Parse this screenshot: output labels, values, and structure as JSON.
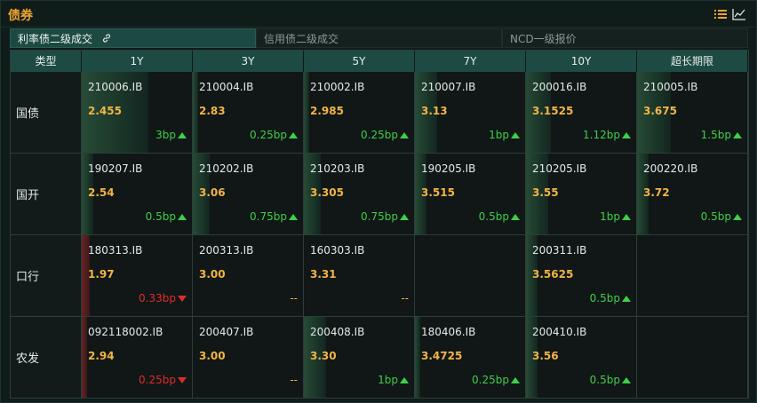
{
  "header": {
    "title": "债券",
    "list_icon": "list-icon",
    "chart_icon": "line-chart-icon",
    "accent": "#f0a531"
  },
  "tabs": [
    {
      "label": "利率债二级成交",
      "active": true,
      "icon": "link-icon"
    },
    {
      "label": "信用债二级成交",
      "active": false
    },
    {
      "label": "NCD一级报价",
      "active": false
    }
  ],
  "table": {
    "corner": "类型",
    "columns": [
      "1Y",
      "3Y",
      "5Y",
      "7Y",
      "10Y",
      "超长期限"
    ],
    "rows": [
      {
        "label": "国债",
        "cells": [
          {
            "code": "210006.IB",
            "yield": "2.455",
            "change": "3bp",
            "dir": "up",
            "bar": 0.6
          },
          {
            "code": "210004.IB",
            "yield": "2.83",
            "change": "0.25bp",
            "dir": "up",
            "bar": 0.05
          },
          {
            "code": "210002.IB",
            "yield": "2.985",
            "change": "0.25bp",
            "dir": "up",
            "bar": 0.05
          },
          {
            "code": "210007.IB",
            "yield": "3.13",
            "change": "1bp",
            "dir": "up",
            "bar": 0.2
          },
          {
            "code": "200016.IB",
            "yield": "3.1525",
            "change": "1.12bp",
            "dir": "up",
            "bar": 0.22
          },
          {
            "code": "210005.IB",
            "yield": "3.675",
            "change": "1.5bp",
            "dir": "up",
            "bar": 0.3
          }
        ]
      },
      {
        "label": "国开",
        "cells": [
          {
            "code": "190207.IB",
            "yield": "2.54",
            "change": "0.5bp",
            "dir": "up",
            "bar": 0.1
          },
          {
            "code": "210202.IB",
            "yield": "3.06",
            "change": "0.75bp",
            "dir": "up",
            "bar": 0.15
          },
          {
            "code": "210203.IB",
            "yield": "3.305",
            "change": "0.75bp",
            "dir": "up",
            "bar": 0.15
          },
          {
            "code": "190205.IB",
            "yield": "3.515",
            "change": "0.5bp",
            "dir": "up",
            "bar": 0.1
          },
          {
            "code": "210205.IB",
            "yield": "3.55",
            "change": "1bp",
            "dir": "up",
            "bar": 0.2
          },
          {
            "code": "200220.IB",
            "yield": "3.72",
            "change": "0.5bp",
            "dir": "up",
            "bar": 0.1
          }
        ]
      },
      {
        "label": "口行",
        "cells": [
          {
            "code": "180313.IB",
            "yield": "1.97",
            "change": "0.33bp",
            "dir": "down",
            "bar": 0.07
          },
          {
            "code": "200313.IB",
            "yield": "3.00",
            "change": "--",
            "dir": "flat",
            "bar": 0
          },
          {
            "code": "160303.IB",
            "yield": "3.31",
            "change": "--",
            "dir": "flat",
            "bar": 0
          },
          {
            "code": "",
            "yield": "",
            "change": "",
            "dir": "none",
            "bar": 0
          },
          {
            "code": "200311.IB",
            "yield": "3.5625",
            "change": "0.5bp",
            "dir": "up",
            "bar": 0.1
          },
          {
            "code": "",
            "yield": "",
            "change": "",
            "dir": "none",
            "bar": 0
          }
        ]
      },
      {
        "label": "农发",
        "cells": [
          {
            "code": "092118002.IB",
            "yield": "2.94",
            "change": "0.25bp",
            "dir": "down",
            "bar": 0.05
          },
          {
            "code": "200407.IB",
            "yield": "3.00",
            "change": "--",
            "dir": "flat",
            "bar": 0
          },
          {
            "code": "200408.IB",
            "yield": "3.30",
            "change": "1bp",
            "dir": "up",
            "bar": 0.2
          },
          {
            "code": "180406.IB",
            "yield": "3.4725",
            "change": "0.25bp",
            "dir": "up",
            "bar": 0.05
          },
          {
            "code": "200410.IB",
            "yield": "3.56",
            "change": "0.5bp",
            "dir": "up",
            "bar": 0.1
          },
          {
            "code": "",
            "yield": "",
            "change": "",
            "dir": "none",
            "bar": 0
          }
        ]
      }
    ]
  },
  "colors": {
    "up": "#3ecf4a",
    "down": "#e22b2b",
    "yield": "#f3b445",
    "header_bg": "#1d4a43"
  }
}
